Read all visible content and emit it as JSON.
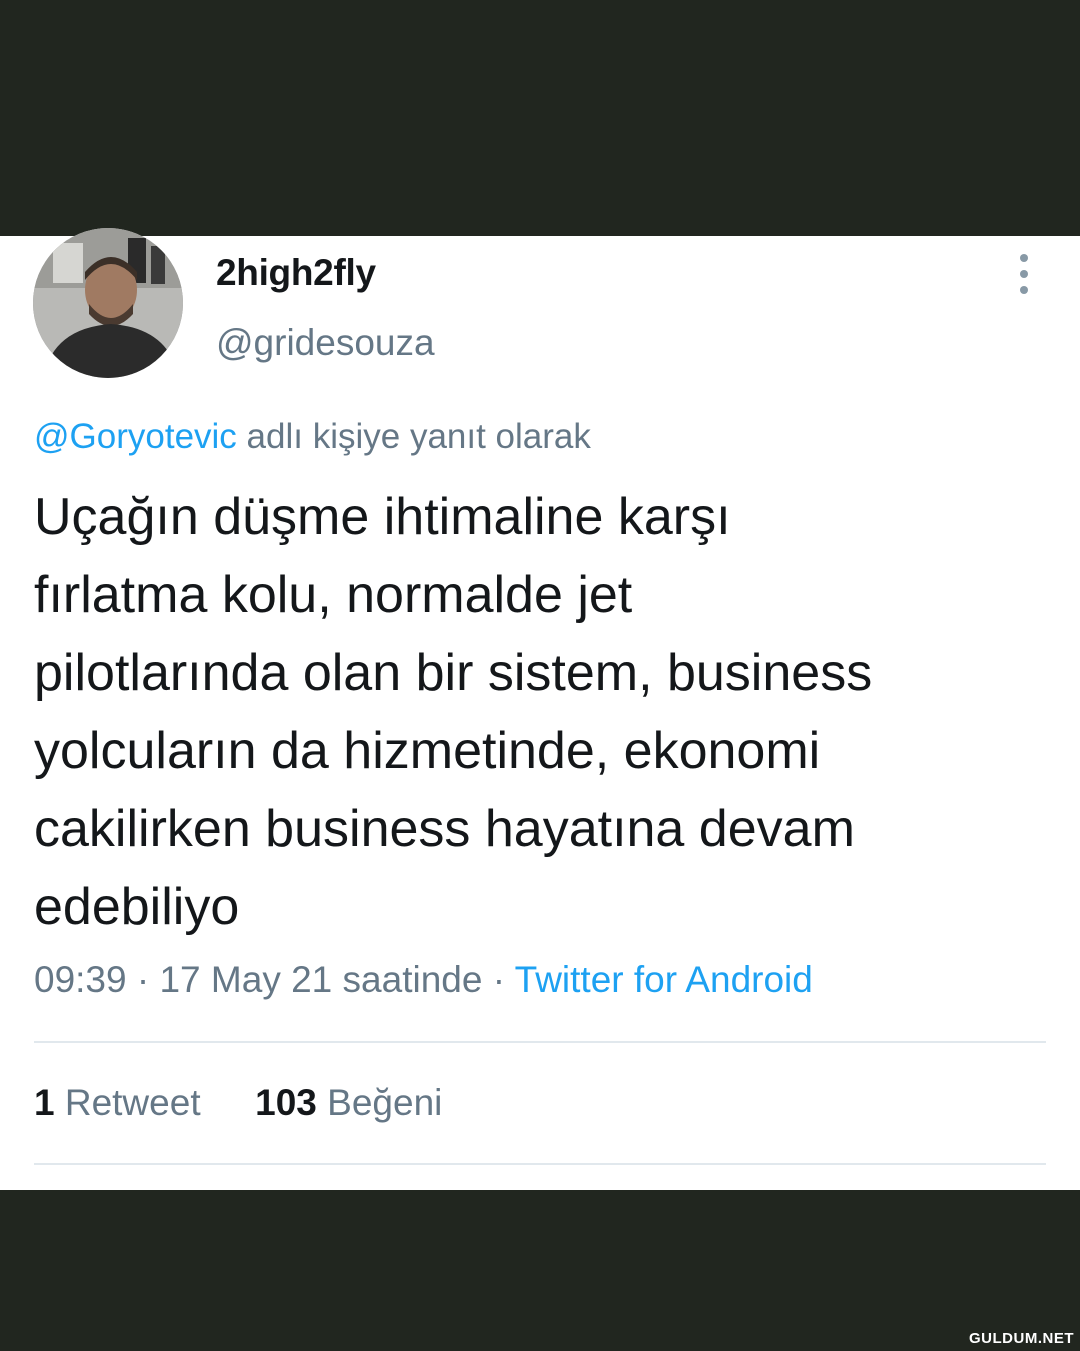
{
  "tweet": {
    "display_name": "2high2fly",
    "handle": "@gridesouza",
    "reply_mention": "@Goryotevic",
    "reply_suffix": "adlı kişiye yanıt olarak",
    "text_lines": [
      "Uçağın düşme ihtimaline karşı",
      "fırlatma kolu, normalde jet",
      "pilotlarında olan bir sistem, business",
      "yolcuların da hizmetinde, ekonomi",
      "cakilirken business hayatına devam",
      "edebiliyo"
    ],
    "time": "09:39",
    "date": "17 May 21 saatinde",
    "source": "Twitter for Android",
    "retweet_count": "1",
    "retweet_label": "Retweet",
    "like_count": "103",
    "like_label": "Beğeni"
  },
  "icons": {
    "more": "more-vertical-icon"
  },
  "colors": {
    "accent": "#1da1f2",
    "secondary_text": "#657786",
    "primary_text": "#14171a",
    "background_band": "#21261f"
  },
  "watermark": "GULDUM.NET"
}
